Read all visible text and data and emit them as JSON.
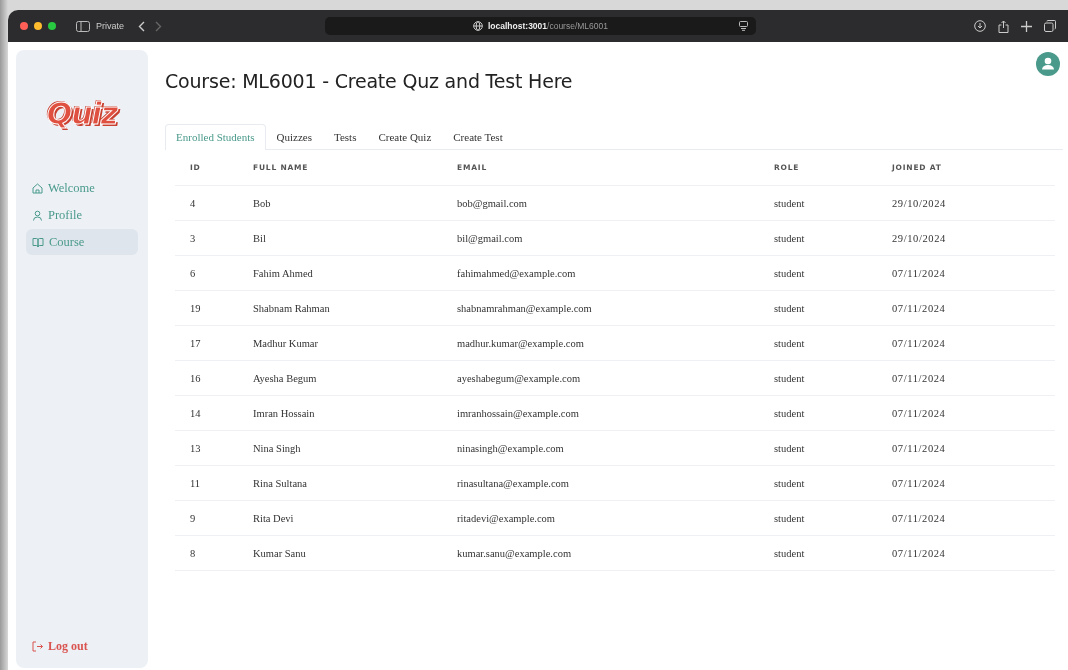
{
  "browser": {
    "mode": "Private",
    "url": "**localhost:3001**/course/ML6001"
  },
  "sidebar": {
    "logo": "Quiz",
    "items": [
      {
        "label": "Welcome",
        "kind": "home",
        "selected": false
      },
      {
        "label": "Profile",
        "kind": "user",
        "selected": false
      },
      {
        "label": "Course",
        "kind": "book",
        "selected": true
      }
    ],
    "logout": "Log out"
  },
  "page": {
    "title": "Course: ML6001 - Create Quz and Test Here"
  },
  "tabs": [
    {
      "label": "Enrolled Students",
      "selected": true
    },
    {
      "label": "Quizzes",
      "selected": false
    },
    {
      "label": "Tests",
      "selected": false
    },
    {
      "label": "Create Quiz",
      "selected": false
    },
    {
      "label": "Create Test",
      "selected": false
    }
  ],
  "table": {
    "columns": [
      "ID",
      "FULL NAME",
      "EMAIL",
      "ROLE",
      "JOINED AT"
    ],
    "rows": [
      [
        "4",
        "Bob",
        "bob@gmail.com",
        "student",
        "29/10/2024"
      ],
      [
        "3",
        "Bil",
        "bil@gmail.com",
        "student",
        "29/10/2024"
      ],
      [
        "6",
        "Fahim Ahmed",
        "fahimahmed@example.com",
        "student",
        "07/11/2024"
      ],
      [
        "19",
        "Shabnam Rahman",
        "shabnamrahman@example.com",
        "student",
        "07/11/2024"
      ],
      [
        "17",
        "Madhur Kumar",
        "madhur.kumar@example.com",
        "student",
        "07/11/2024"
      ],
      [
        "16",
        "Ayesha Begum",
        "ayeshabegum@example.com",
        "student",
        "07/11/2024"
      ],
      [
        "14",
        "Imran Hossain",
        "imranhossain@example.com",
        "student",
        "07/11/2024"
      ],
      [
        "13",
        "Nina Singh",
        "ninasingh@example.com",
        "student",
        "07/11/2024"
      ],
      [
        "11",
        "Rina Sultana",
        "rinasultana@example.com",
        "student",
        "07/11/2024"
      ],
      [
        "9",
        "Rita Devi",
        "ritadevi@example.com",
        "student",
        "07/11/2024"
      ],
      [
        "8",
        "Kumar Sanu",
        "kumar.sanu@example.com",
        "student",
        "07/11/2024"
      ]
    ]
  }
}
